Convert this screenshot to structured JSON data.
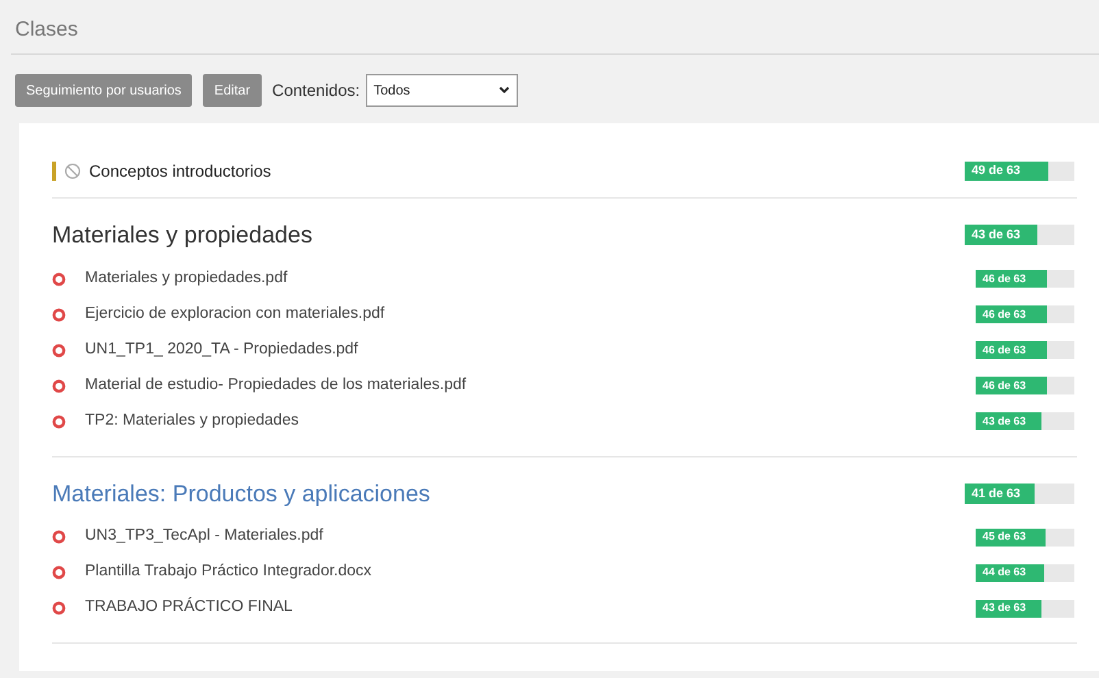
{
  "page": {
    "title": "Clases"
  },
  "toolbar": {
    "buttons": [
      "Seguimiento por usuarios",
      "Editar"
    ],
    "filter": {
      "label": "Contenidos:",
      "value": "Todos"
    }
  },
  "sections": [
    {
      "kind": "hidden",
      "title": "Conceptos introductorios",
      "link": false,
      "progress": {
        "text": "49 de 63",
        "level": 0.76
      }
    },
    {
      "kind": "heading",
      "title": "Materiales y propiedades",
      "link": false,
      "progress": {
        "text": "43 de 63",
        "level": 0.66
      },
      "items": [
        {
          "title": "Materiales y propiedades.pdf",
          "progress": {
            "text": "46 de 63",
            "level": 0.72
          }
        },
        {
          "title": "Ejercicio de exploracion con materiales.pdf",
          "progress": {
            "text": "46 de 63",
            "level": 0.72
          }
        },
        {
          "title": "UN1_TP1_ 2020_TA - Propiedades.pdf",
          "progress": {
            "text": "46 de 63",
            "level": 0.72
          }
        },
        {
          "title": "Material de estudio- Propiedades de los materiales.pdf",
          "progress": {
            "text": "46 de 63",
            "level": 0.72
          }
        },
        {
          "title": "TP2: Materiales y propiedades",
          "progress": {
            "text": "43 de 63",
            "level": 0.67
          }
        }
      ]
    },
    {
      "kind": "heading",
      "title": "Materiales: Productos y aplicaciones",
      "link": true,
      "progress": {
        "text": "41 de 63",
        "level": 0.64
      },
      "items": [
        {
          "title": "UN3_TP3_TecApl - Materiales.pdf",
          "progress": {
            "text": "45 de 63",
            "level": 0.71
          }
        },
        {
          "title": "Plantilla Trabajo Práctico Integrador.docx",
          "progress": {
            "text": "44 de 63",
            "level": 0.7
          }
        },
        {
          "title": "TRABAJO PRÁCTICO FINAL",
          "progress": {
            "text": "43 de 63",
            "level": 0.67
          }
        }
      ]
    }
  ]
}
